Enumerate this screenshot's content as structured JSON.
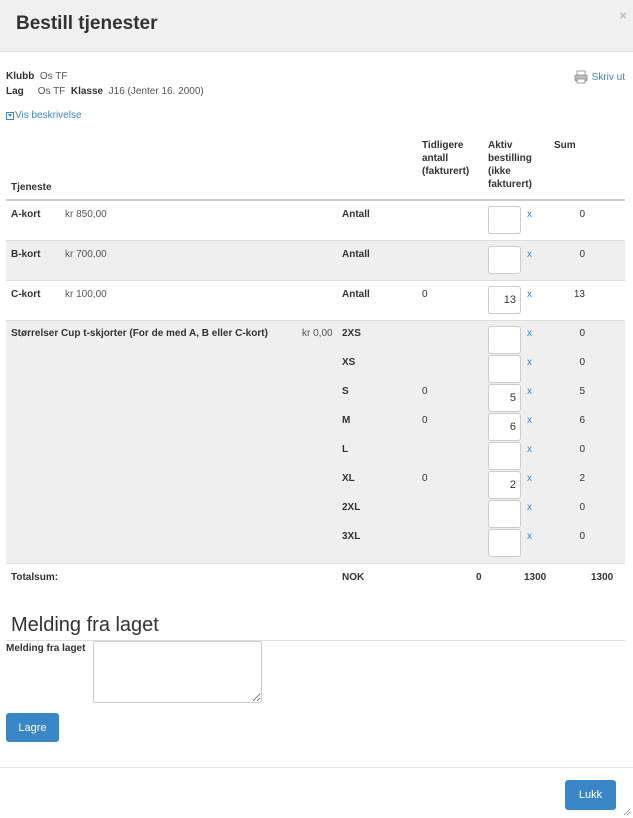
{
  "modal": {
    "title": "Bestill tjenester",
    "close_glyph": "×"
  },
  "info": {
    "klubb_label": "Klubb",
    "klubb_value": "Os TF",
    "lag_label": "Lag",
    "lag_value": "Os TF",
    "klasse_label": "Klasse",
    "klasse_value": "J16 (Jenter 16. 2000)"
  },
  "print_label": "Skriv ut",
  "description_toggle": "Vis beskrivelse",
  "table": {
    "headers": {
      "tjeneste": "Tjeneste",
      "tidligere_1": "Tidligere",
      "tidligere_2": "antall",
      "tidligere_3": "(fakturert)",
      "aktiv_1": "Aktiv",
      "aktiv_2": "bestilling",
      "aktiv_3": "(ikke",
      "aktiv_4": "fakturert)",
      "sum": "Sum"
    },
    "services": [
      {
        "name": "A-kort",
        "price": "kr 850,00",
        "unit": "Antall",
        "previous": "",
        "qty": "",
        "x": "x",
        "sum": "0"
      },
      {
        "name": "B-kort",
        "price": "kr 700,00",
        "unit": "Antall",
        "previous": "",
        "qty": "",
        "x": "x",
        "sum": "0"
      },
      {
        "name": "C-kort",
        "price": "kr 100,00",
        "unit": "Antall",
        "previous": "0",
        "qty": "13",
        "x": "x",
        "sum": "13"
      }
    ],
    "tshirt": {
      "name": "Størrelser Cup t-skjorter (For de med A, B eller C-kort)",
      "price": "kr 0,00",
      "sizes": [
        {
          "size": "2XS",
          "previous": "",
          "qty": "",
          "x": "x",
          "sum": "0"
        },
        {
          "size": "XS",
          "previous": "",
          "qty": "",
          "x": "x",
          "sum": "0"
        },
        {
          "size": "S",
          "previous": "0",
          "qty": "5",
          "x": "x",
          "sum": "5"
        },
        {
          "size": "M",
          "previous": "0",
          "qty": "6",
          "x": "x",
          "sum": "6"
        },
        {
          "size": "L",
          "previous": "",
          "qty": "",
          "x": "x",
          "sum": "0"
        },
        {
          "size": "XL",
          "previous": "0",
          "qty": "2",
          "x": "x",
          "sum": "2"
        },
        {
          "size": "2XL",
          "previous": "",
          "qty": "",
          "x": "x",
          "sum": "0"
        },
        {
          "size": "3XL",
          "previous": "",
          "qty": "",
          "x": "x",
          "sum": "0"
        }
      ]
    },
    "total": {
      "label": "Totalsum:",
      "currency": "NOK",
      "previous": "0",
      "active": "1300",
      "sum": "1300"
    }
  },
  "message": {
    "section_title": "Melding fra laget",
    "label": "Melding fra laget",
    "value": ""
  },
  "buttons": {
    "save": "Lagre",
    "close": "Lukk"
  },
  "colors": {
    "accent": "#3a87c8",
    "header_bg": "#f0f0f0",
    "row_alt_bg": "#efefef"
  }
}
